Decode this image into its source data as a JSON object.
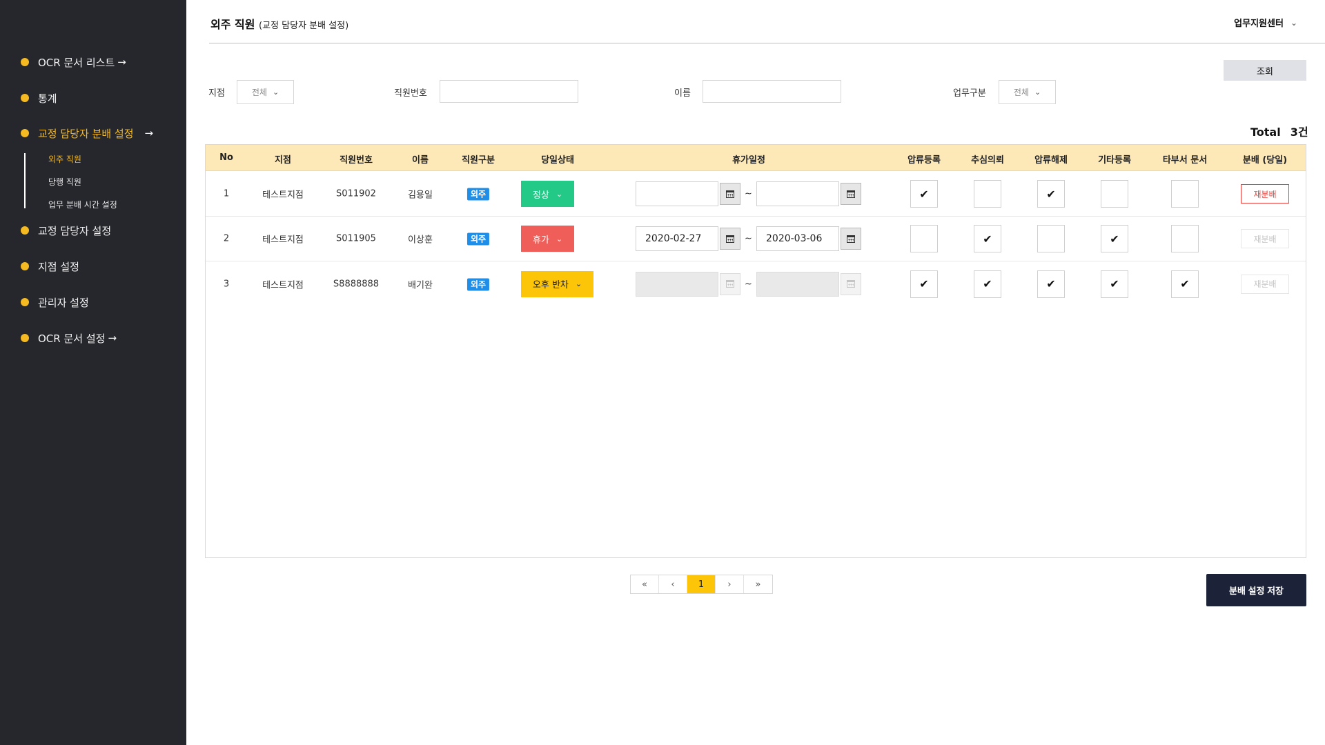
{
  "sidebar": {
    "items": [
      {
        "label": "OCR 문서 리스트",
        "arrow": "→"
      },
      {
        "label": "통계"
      },
      {
        "label": "교정 담당자 분배 설정",
        "arrow": "→"
      },
      {
        "label": "교정 담당자 설정"
      },
      {
        "label": "지점 설정"
      },
      {
        "label": "관리자 설정"
      },
      {
        "label": "OCR 문서 설정",
        "arrow": "→"
      }
    ],
    "subitems": [
      "외주 직원",
      "당행 직원",
      "업무 분배 시간 설정"
    ],
    "accent_color": "#f5b921"
  },
  "header": {
    "title": "외주 직원",
    "subtitle": "(교정 담당자 분배 설정)",
    "center_menu": "업무지원센터",
    "center_menu_icon": "chevron-down-icon"
  },
  "filters": {
    "query_button": "조회",
    "branch_label": "지점",
    "branch_value": "전체",
    "emp_no_label": "직원번호",
    "emp_no_value": "",
    "name_label": "이름",
    "name_value": "",
    "work_type_label": "업무구분",
    "work_type_value": "전체"
  },
  "summary": {
    "total_label": "Total",
    "total_value": "3건"
  },
  "table": {
    "columns": [
      "No",
      "지점",
      "직원번호",
      "이름",
      "직원구분",
      "당일상태",
      "휴가일정",
      "압류등록",
      "추심의뢰",
      "압류해제",
      "기타등록",
      "타부서 문서",
      "분배 (당일)"
    ],
    "rows": [
      {
        "no": "1",
        "branch": "테스트지점",
        "emp_no": "S011902",
        "name": "김용일",
        "type": "외주",
        "status": "정상",
        "status_color": "#23c987",
        "vac_start": "",
        "vac_end": "",
        "vac_disabled": false,
        "checks": [
          "✔",
          "",
          "✔",
          "",
          ""
        ],
        "redistribute": "재분배",
        "redistribute_active": true
      },
      {
        "no": "2",
        "branch": "테스트지점",
        "emp_no": "S011905",
        "name": "이상훈",
        "type": "외주",
        "status": "휴가",
        "status_color": "#f05e59",
        "vac_start": "2020-02-27",
        "vac_end": "2020-03-06",
        "vac_disabled": false,
        "checks": [
          "",
          "✔",
          "",
          "✔",
          ""
        ],
        "redistribute": "재분배",
        "redistribute_active": false
      },
      {
        "no": "3",
        "branch": "테스트지점",
        "emp_no": "S8888888",
        "name": "배기완",
        "type": "외주",
        "status": "오후 반차",
        "status_color": "#fcc507",
        "vac_start": "",
        "vac_end": "",
        "vac_disabled": true,
        "checks": [
          "✔",
          "✔",
          "✔",
          "✔",
          "✔"
        ],
        "redistribute": "재분배",
        "redistribute_active": false
      }
    ],
    "tilde": "~"
  },
  "pagination": {
    "first": "«",
    "prev": "‹",
    "current": "1",
    "next": "›",
    "last": "»"
  },
  "actions": {
    "save": "분배 설정 저장"
  }
}
